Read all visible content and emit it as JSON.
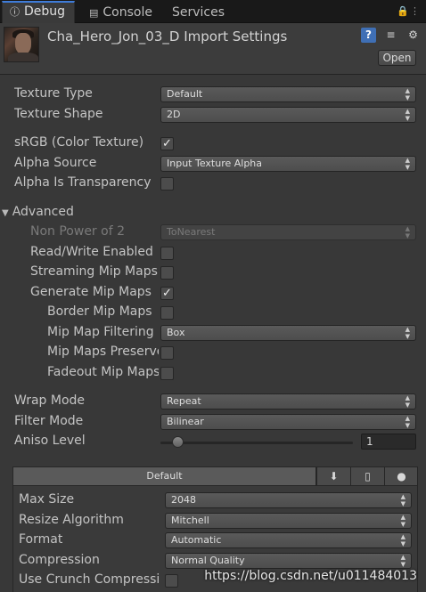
{
  "tabs": [
    {
      "label": "Debug",
      "icon": "info-icon"
    },
    {
      "label": "Console",
      "icon": "console-icon"
    },
    {
      "label": "Services"
    }
  ],
  "header": {
    "title": "Cha_Hero_Jon_03_D Import Settings",
    "open_label": "Open"
  },
  "fields": {
    "texture_type": {
      "label": "Texture Type",
      "value": "Default"
    },
    "texture_shape": {
      "label": "Texture Shape",
      "value": "2D"
    },
    "srgb": {
      "label": "sRGB (Color Texture)",
      "checked": true
    },
    "alpha_source": {
      "label": "Alpha Source",
      "value": "Input Texture Alpha"
    },
    "alpha_transparency": {
      "label": "Alpha Is Transparency",
      "checked": false
    },
    "advanced": {
      "label": "Advanced"
    },
    "non_power_of_2": {
      "label": "Non Power of 2",
      "value": "ToNearest"
    },
    "read_write": {
      "label": "Read/Write Enabled",
      "checked": false
    },
    "streaming_mips": {
      "label": "Streaming Mip Maps",
      "checked": false
    },
    "generate_mips": {
      "label": "Generate Mip Maps",
      "checked": true
    },
    "border_mips": {
      "label": "Border Mip Maps",
      "checked": false
    },
    "mip_filtering": {
      "label": "Mip Map Filtering",
      "value": "Box"
    },
    "mips_preserve": {
      "label": "Mip Maps Preserve",
      "checked": false
    },
    "fadeout_mips": {
      "label": "Fadeout Mip Maps",
      "checked": false
    },
    "wrap_mode": {
      "label": "Wrap Mode",
      "value": "Repeat"
    },
    "filter_mode": {
      "label": "Filter Mode",
      "value": "Bilinear"
    },
    "aniso_level": {
      "label": "Aniso Level",
      "value": "1",
      "level": 1,
      "min": 0,
      "max": 16
    }
  },
  "platform": {
    "default_label": "Default",
    "icons": [
      "download-icon",
      "mobile-icon",
      "android-icon"
    ],
    "max_size": {
      "label": "Max Size",
      "value": "2048"
    },
    "resize_algorithm": {
      "label": "Resize Algorithm",
      "value": "Mitchell"
    },
    "format": {
      "label": "Format",
      "value": "Automatic"
    },
    "compression": {
      "label": "Compression",
      "value": "Normal Quality"
    },
    "crunch": {
      "label": "Use Crunch Compressi",
      "checked": false
    }
  },
  "watermark": "https://blog.csdn.net/u011484013",
  "colors": {
    "background": "#383838",
    "tab_accent": "#3f7cd9",
    "help_icon": "#3f6fb5"
  }
}
